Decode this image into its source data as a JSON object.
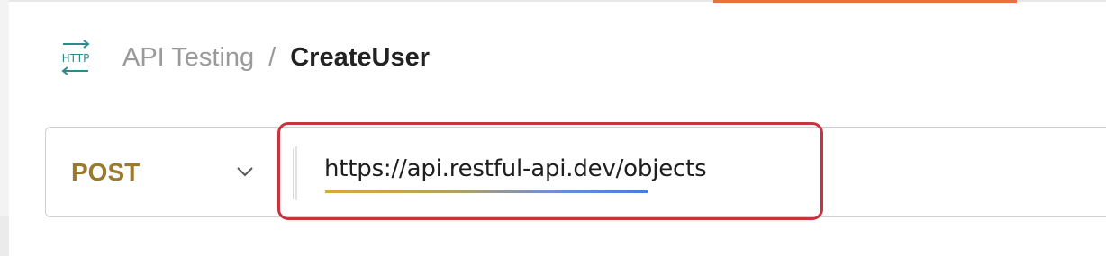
{
  "colors": {
    "accent_tab": "#e8723f",
    "method": "#9b7a2d",
    "highlight_border": "#c8343d",
    "icon": "#2f8a8a"
  },
  "breadcrumb": {
    "icon": "http-icon",
    "icon_text": "HTTP",
    "parent": "API Testing",
    "separator": "/",
    "current": "CreateUser"
  },
  "request": {
    "method": "POST",
    "method_chevron_icon": "chevron-down-icon",
    "url": "https://api.restful-api.dev/objects"
  }
}
